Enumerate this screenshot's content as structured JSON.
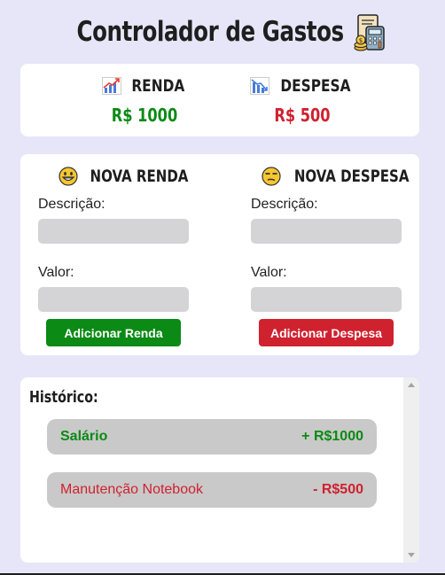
{
  "app": {
    "title": "Controlador de Gastos",
    "title_icon": "calculator-money-icon"
  },
  "summary": {
    "income": {
      "label": "RENDA",
      "value": "R$ 1000",
      "icon": "chart-up-icon",
      "color": "#0b8a15"
    },
    "expense": {
      "label": "DESPESA",
      "value": "R$ 500",
      "icon": "chart-down-icon",
      "color": "#d0212f"
    }
  },
  "forms": {
    "income": {
      "title": "NOVA RENDA",
      "emoji": "grinning-face-icon",
      "description_label": "Descrição:",
      "description_value": "",
      "value_label": "Valor:",
      "value_value": "",
      "button_label": "Adicionar Renda"
    },
    "expense": {
      "title": "NOVA DESPESA",
      "emoji": "unamused-face-icon",
      "description_label": "Descrição:",
      "description_value": "",
      "value_label": "Valor:",
      "value_value": "",
      "button_label": "Adicionar Despesa"
    }
  },
  "history": {
    "title": "Histórico:",
    "items": [
      {
        "description": "Salário",
        "amount": "+ R$1000",
        "type": "income"
      },
      {
        "description": "Manutenção Notebook",
        "amount": "- R$500",
        "type": "expense"
      }
    ]
  },
  "colors": {
    "background": "#e6e6f8",
    "income": "#0b8a15",
    "expense": "#d0212f",
    "card": "#ffffff",
    "input": "#d4d4d6",
    "history_item": "#c9c9c9"
  }
}
